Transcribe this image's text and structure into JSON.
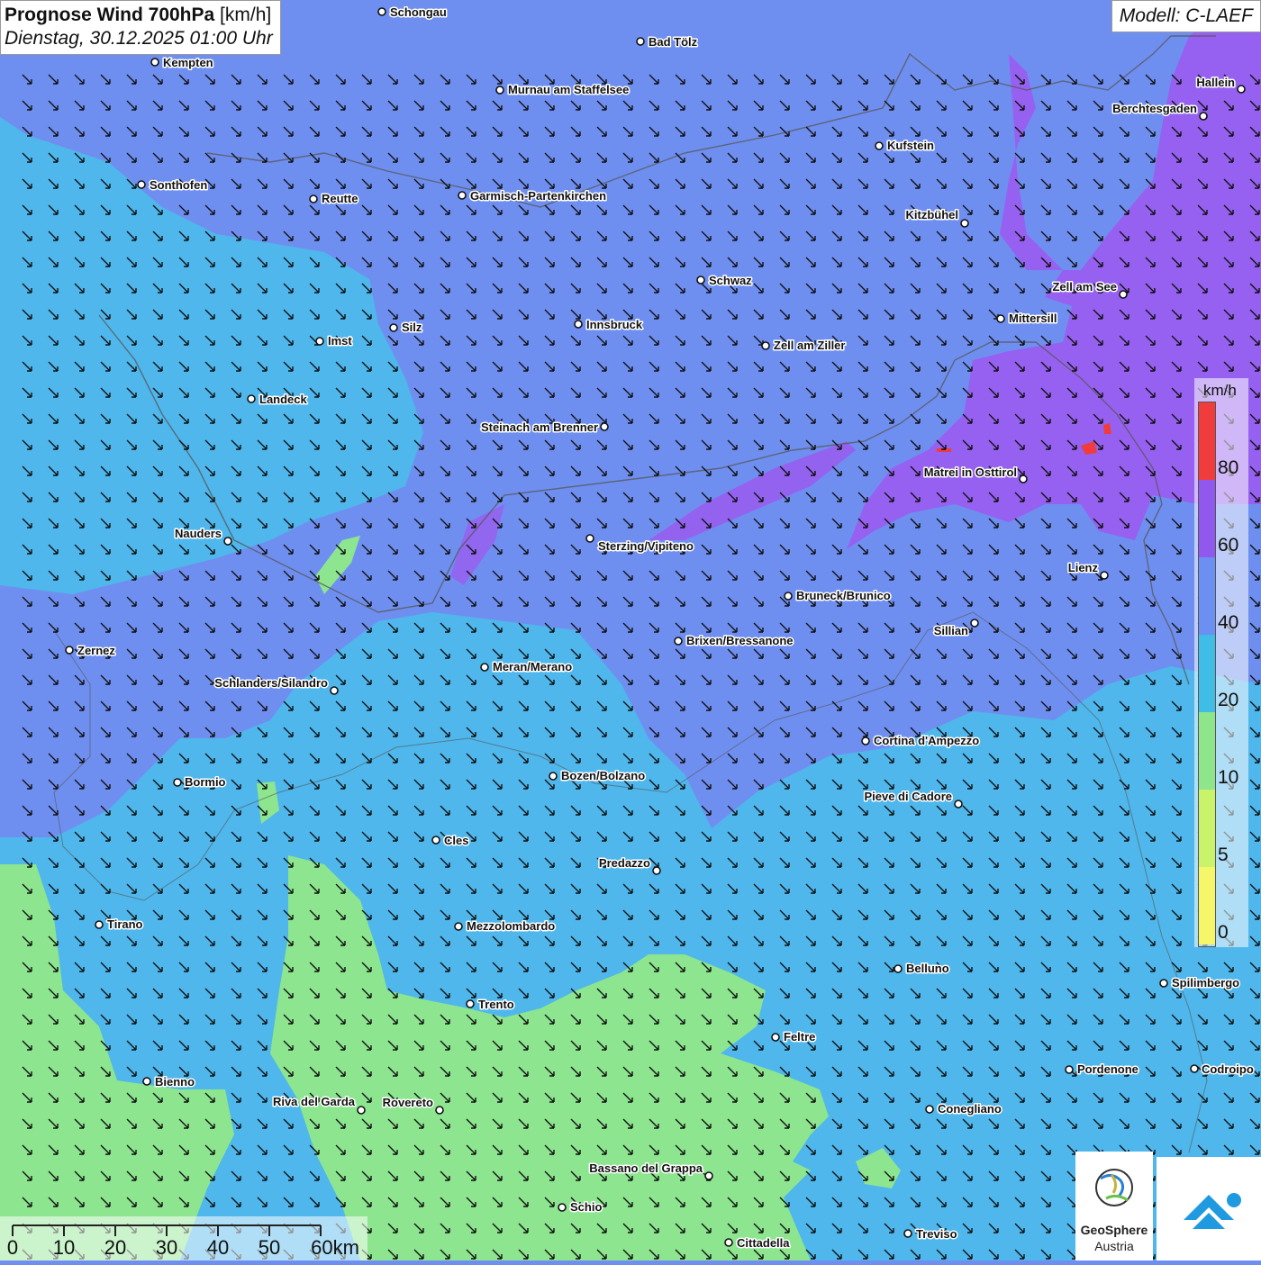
{
  "header": {
    "title": "Prognose Wind 700hPa",
    "unit": "[km/h]",
    "datetime": "Dienstag, 30.12.2025 01:00 Uhr"
  },
  "model": {
    "label": "Modell: C-LAEF"
  },
  "legend": {
    "unit": "km/h",
    "ticks": [
      "80",
      "60",
      "40",
      "20",
      "10",
      "5",
      "0"
    ],
    "colors": [
      "#f03c3c",
      "#9158ee",
      "#6b8ff2",
      "#3fbde6",
      "#8ee58c",
      "#c9f36b",
      "#f6f66a"
    ]
  },
  "scale": {
    "labels": [
      "0",
      "10",
      "20",
      "30",
      "40",
      "50",
      "60km"
    ]
  },
  "logo": {
    "line1": "GeoSphere",
    "line2": "Austria"
  },
  "background": {
    "base_color": "#4fb7ec",
    "strong_color": "#6f8ff0",
    "very_strong_color": "#9a5cf0",
    "calm_color": "#8de58f",
    "wind_direction": "north-west"
  },
  "cities": [
    "Schongau",
    "Bad Tölz",
    "Kempten",
    "Murnau am Staffelsee",
    "Hallein",
    "Berchtesgaden",
    "Kufstein",
    "Sonthofen",
    "Reutte",
    "Garmisch-Partenkirchen",
    "Kitzbühel",
    "Schwaz",
    "Zell am See",
    "Mittersill",
    "Silz",
    "Imst",
    "Innsbruck",
    "Zell am Ziller",
    "Landeck",
    "Steinach am Brenner",
    "Matrei in Osttirol",
    "Nauders",
    "Sterzing/Vipiteno",
    "Lienz",
    "Bruneck/Brunico",
    "Sillian",
    "Brixen/Bressanone",
    "Zernez",
    "Meran/Merano",
    "Schlanders/Silandro",
    "Cortina d'Ampezzo",
    "Bozen/Bolzano",
    "Bormio",
    "Pieve di Cadore",
    "Cles",
    "Predazzo",
    "Tirano",
    "Mezzolombardo",
    "Belluno",
    "Spilimbergo",
    "Trento",
    "Feltre",
    "Pordenone",
    "Codroipo",
    "Bienno",
    "Riva del Garda",
    "Rovereto",
    "Conegliano",
    "Bassano del Grappa",
    "Schio",
    "Treviso",
    "Cittadella"
  ]
}
